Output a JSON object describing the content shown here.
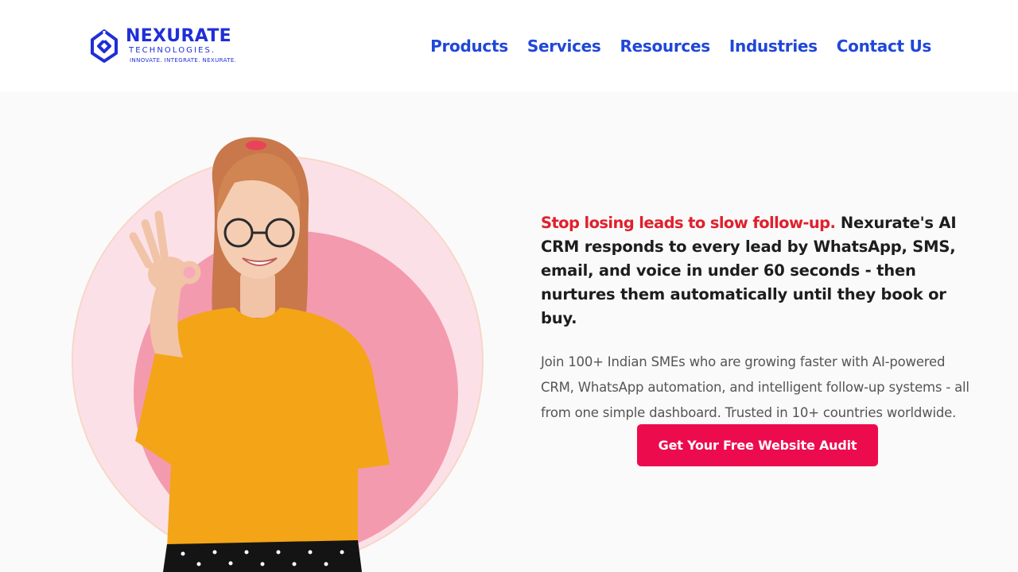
{
  "header": {
    "logo": {
      "name": "NEXURATE",
      "subtitle": "TECHNOLOGIES.",
      "tagline": "INNOVATE. INTEGRATE. NEXURATE.",
      "icon": "nexurate-mark-icon"
    },
    "nav": [
      {
        "label": "Products"
      },
      {
        "label": "Services"
      },
      {
        "label": "Resources"
      },
      {
        "label": "Industries"
      },
      {
        "label": "Contact Us"
      }
    ]
  },
  "hero": {
    "headline_accent": "Stop losing leads to slow follow-up.",
    "headline_rest": " Nexurate's AI CRM responds to every lead by WhatsApp, SMS, email, and voice in under 60 seconds - then nurtures them automatically until they book or buy.",
    "subtext": "Join 100+ Indian SMEs who are growing faster with AI-powered CRM, WhatsApp automation, and intelligent follow-up systems - all from one simple dashboard. Trusted in 10+ countries worldwide.",
    "cta_label": "Get Your Free Website Audit"
  },
  "colors": {
    "brand_blue": "#1f2fd8",
    "nav_blue": "#1f47d8",
    "accent_red": "#e0202d",
    "cta_pink": "#ec0c4e",
    "circle_pink": "#f49aae"
  }
}
